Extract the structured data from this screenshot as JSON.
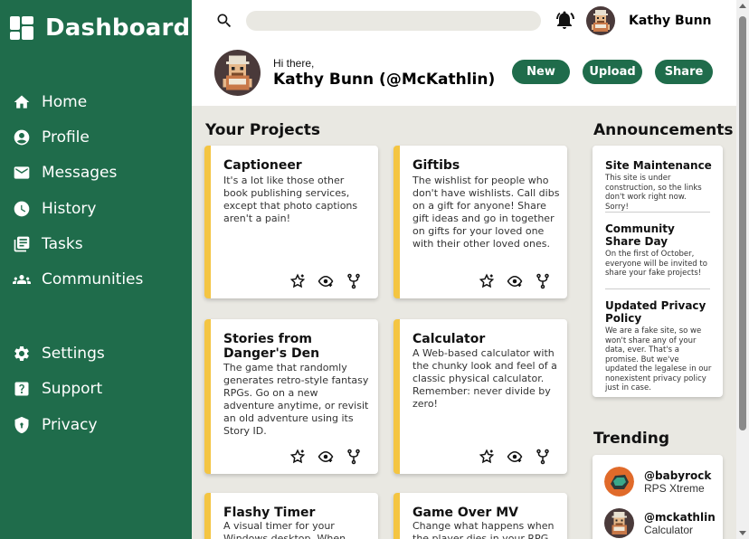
{
  "app": {
    "title": "Dashboard"
  },
  "sidebar": {
    "items": [
      {
        "label": "Home",
        "icon": "home-icon"
      },
      {
        "label": "Profile",
        "icon": "profile-icon"
      },
      {
        "label": "Messages",
        "icon": "mail-icon"
      },
      {
        "label": "History",
        "icon": "clock-icon"
      },
      {
        "label": "Tasks",
        "icon": "copy-icon"
      },
      {
        "label": "Communities",
        "icon": "people-icon"
      }
    ],
    "bottom_items": [
      {
        "label": "Settings",
        "icon": "gear-icon"
      },
      {
        "label": "Support",
        "icon": "question-icon"
      },
      {
        "label": "Privacy",
        "icon": "shield-icon"
      }
    ]
  },
  "header": {
    "search_placeholder": "",
    "user_name": "Kathy Bunn",
    "greeting": "Hi there,",
    "full_name": "Kathy Bunn (@McKathlin)",
    "buttons": {
      "new": "New",
      "upload": "Upload",
      "share": "Share"
    }
  },
  "projects": {
    "title": "Your Projects",
    "items": [
      {
        "title": "Captioneer",
        "desc": "It's a lot like those other book publishing services, except that photo captions aren't a pain!"
      },
      {
        "title": "Giftibs",
        "desc": "The wishlist for people who don't have wishlists. Call dibs on a gift for anyone! Share gift ideas and go in together on gifts for your loved one with their other loved ones."
      },
      {
        "title": "Stories from Danger's Den",
        "desc": "The game that randomly generates retro-style fantasy RPGs. Go on a new adventure anytime, or revisit an old adventure using its Story ID."
      },
      {
        "title": "Calculator",
        "desc": "A Web-based calculator with the chunky look and feel of a classic physical calculator. Remember: never divide by zero!"
      },
      {
        "title": "Flashy Timer",
        "desc": "A visual timer for your Windows desktop. When time runs low"
      },
      {
        "title": "Game Over MV",
        "desc": "Change what happens when the player dies in your RPG Maker"
      }
    ]
  },
  "announcements": {
    "title": "Announcements",
    "items": [
      {
        "title": "Site Maintenance",
        "text": "This site is under construction, so the links don't work right now. Sorry!"
      },
      {
        "title": "Community Share Day",
        "text": "On the first of October, everyone will be invited to share your fake projects!"
      },
      {
        "title": "Updated Privacy Policy",
        "text": "We are a fake site, so we won't share any of your data, ever. That's a promise. But we've updated the legalese in our nonexistent privacy policy just in case."
      }
    ]
  },
  "trending": {
    "title": "Trending",
    "items": [
      {
        "handle": "@babyrock",
        "project": "RPS Xtreme"
      },
      {
        "handle": "@mckathlin",
        "project": "Calculator"
      }
    ]
  },
  "colors": {
    "brand": "#1f6c4b",
    "accent": "#f4c542",
    "background": "#e9e8e2"
  }
}
